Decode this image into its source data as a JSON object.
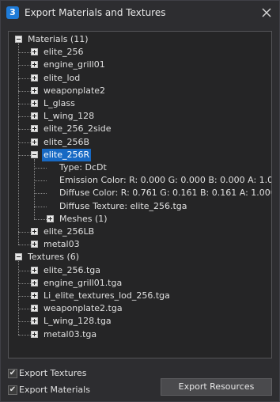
{
  "window": {
    "title": "Export Materials and Textures",
    "app_icon": "3",
    "close_icon": "close-icon"
  },
  "tree": [
    {
      "name": "materials-root",
      "label": "Materials (11)",
      "level": 0,
      "expander": "minus"
    },
    {
      "name": "material-item",
      "label": "elite_256",
      "level": 1,
      "expander": "plus"
    },
    {
      "name": "material-item",
      "label": "engine_grill01",
      "level": 1,
      "expander": "plus"
    },
    {
      "name": "material-item",
      "label": "elite_lod",
      "level": 1,
      "expander": "plus"
    },
    {
      "name": "material-item",
      "label": "weaponplate2",
      "level": 1,
      "expander": "plus"
    },
    {
      "name": "material-item",
      "label": "L_glass",
      "level": 1,
      "expander": "plus"
    },
    {
      "name": "material-item",
      "label": "L_wing_128",
      "level": 1,
      "expander": "plus"
    },
    {
      "name": "material-item",
      "label": "elite_256_2side",
      "level": 1,
      "expander": "plus"
    },
    {
      "name": "material-item",
      "label": "elite_256B",
      "level": 1,
      "expander": "plus"
    },
    {
      "name": "material-item-selected",
      "label": "elite_256R",
      "level": 1,
      "expander": "minus",
      "selected": true
    },
    {
      "name": "material-property",
      "label": "Type: DcDt",
      "level": 2,
      "expander": "none"
    },
    {
      "name": "material-property",
      "label": "Emission Color: R: 0.000 G: 0.000 B: 0.000 A: 1.000",
      "level": 2,
      "expander": "none"
    },
    {
      "name": "material-property",
      "label": "Diffuse Color: R: 0.761 G: 0.161 B: 0.161 A: 1.000",
      "level": 2,
      "expander": "none"
    },
    {
      "name": "material-property",
      "label": "Diffuse Texture: elite_256.tga",
      "level": 2,
      "expander": "none"
    },
    {
      "name": "meshes-node",
      "label": "Meshes (1)",
      "level": 2,
      "expander": "plus"
    },
    {
      "name": "material-item",
      "label": "elite_256LB",
      "level": 1,
      "expander": "plus"
    },
    {
      "name": "material-item",
      "label": "metal03",
      "level": 1,
      "expander": "plus"
    },
    {
      "name": "textures-root",
      "label": "Textures (6)",
      "level": 0,
      "expander": "minus"
    },
    {
      "name": "texture-item",
      "label": "elite_256.tga",
      "level": 1,
      "expander": "plus"
    },
    {
      "name": "texture-item",
      "label": "engine_grill01.tga",
      "level": 1,
      "expander": "plus"
    },
    {
      "name": "texture-item",
      "label": "Li_elite_textures_lod_256.tga",
      "level": 1,
      "expander": "plus"
    },
    {
      "name": "texture-item",
      "label": "weaponplate2.tga",
      "level": 1,
      "expander": "plus"
    },
    {
      "name": "texture-item",
      "label": "L_wing_128.tga",
      "level": 1,
      "expander": "plus"
    },
    {
      "name": "texture-item",
      "label": "metal03.tga",
      "level": 1,
      "expander": "plus"
    }
  ],
  "options": {
    "export_textures": {
      "label": "Export Textures",
      "checked": true
    },
    "export_materials": {
      "label": "Export Materials",
      "checked": true
    },
    "check_glyph": "✔"
  },
  "actions": {
    "export_label": "Export Resources"
  },
  "colors": {
    "background": "#2d2d30",
    "panel": "#252526",
    "selection": "#1769c4",
    "text": "#e0e0e0"
  }
}
